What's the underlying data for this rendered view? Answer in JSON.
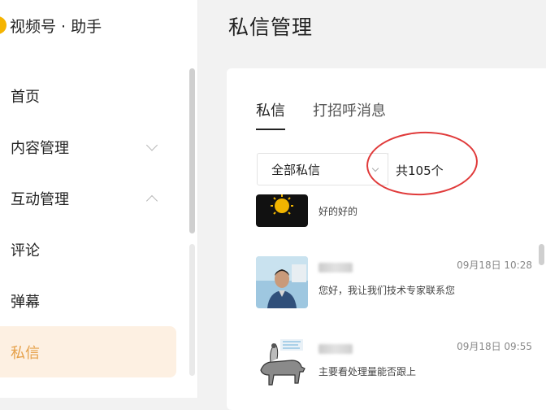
{
  "brand": {
    "title": "视频号 · 助手"
  },
  "sidebar": {
    "items": [
      {
        "label": "首页",
        "chevron": "none"
      },
      {
        "label": "内容管理",
        "chevron": "down"
      },
      {
        "label": "互动管理",
        "chevron": "up"
      },
      {
        "label": "评论",
        "chevron": "none"
      },
      {
        "label": "弹幕",
        "chevron": "none"
      },
      {
        "label": "私信",
        "chevron": "none",
        "active": true
      }
    ]
  },
  "main": {
    "title": "私信管理",
    "tabs": [
      {
        "label": "私信",
        "active": true
      },
      {
        "label": "打招呼消息",
        "active": false
      }
    ],
    "filter": {
      "selected": "全部私信"
    },
    "total": "共105个",
    "messages": [
      {
        "avatar": "sun-avatar",
        "name": "",
        "time": "",
        "text": "好的好的"
      },
      {
        "avatar": "person-avatar",
        "name": "",
        "time": "09月18日 10:28",
        "text": "您好，我让我们技术专家联系您"
      },
      {
        "avatar": "ox-avatar",
        "name": "",
        "time": "09月18日 09:55",
        "text": "主要看处理量能否跟上"
      }
    ]
  },
  "colors": {
    "accent": "#e6a14a",
    "active_bg": "#fdf0e2",
    "annotation": "#e03a3a"
  }
}
